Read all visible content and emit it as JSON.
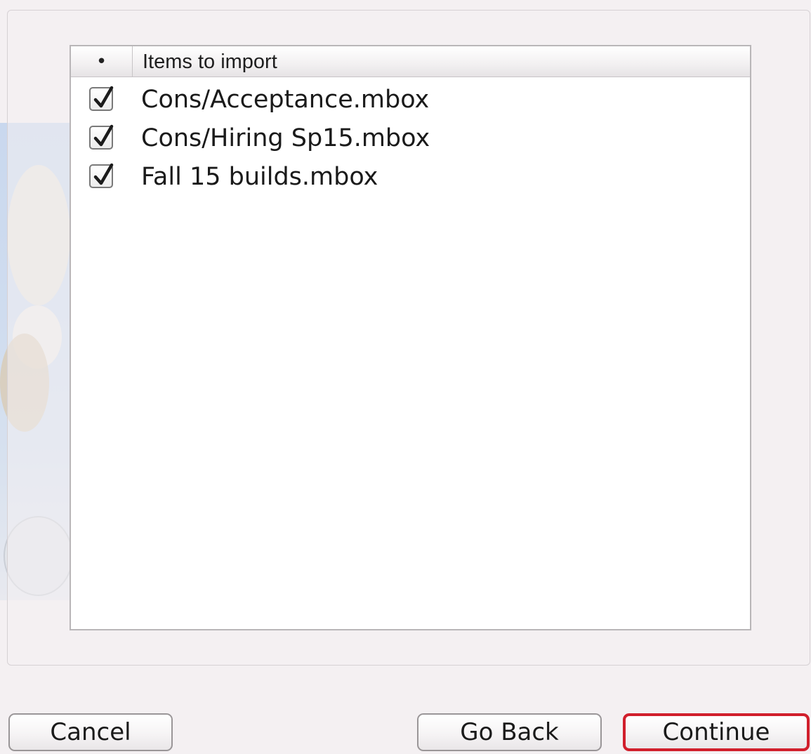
{
  "import_list": {
    "column_check_glyph": "•",
    "column_title": "Items to import",
    "items": [
      {
        "label": "Cons/Acceptance.mbox",
        "checked": true
      },
      {
        "label": "Cons/Hiring Sp15.mbox",
        "checked": true
      },
      {
        "label": "Fall 15 builds.mbox",
        "checked": true
      }
    ]
  },
  "buttons": {
    "cancel": "Cancel",
    "go_back": "Go Back",
    "continue": "Continue"
  },
  "colors": {
    "focus_ring": "#d11f2c",
    "window_background": "#f4f0f2"
  },
  "icons": {
    "checkbox": "checkmark-icon"
  }
}
